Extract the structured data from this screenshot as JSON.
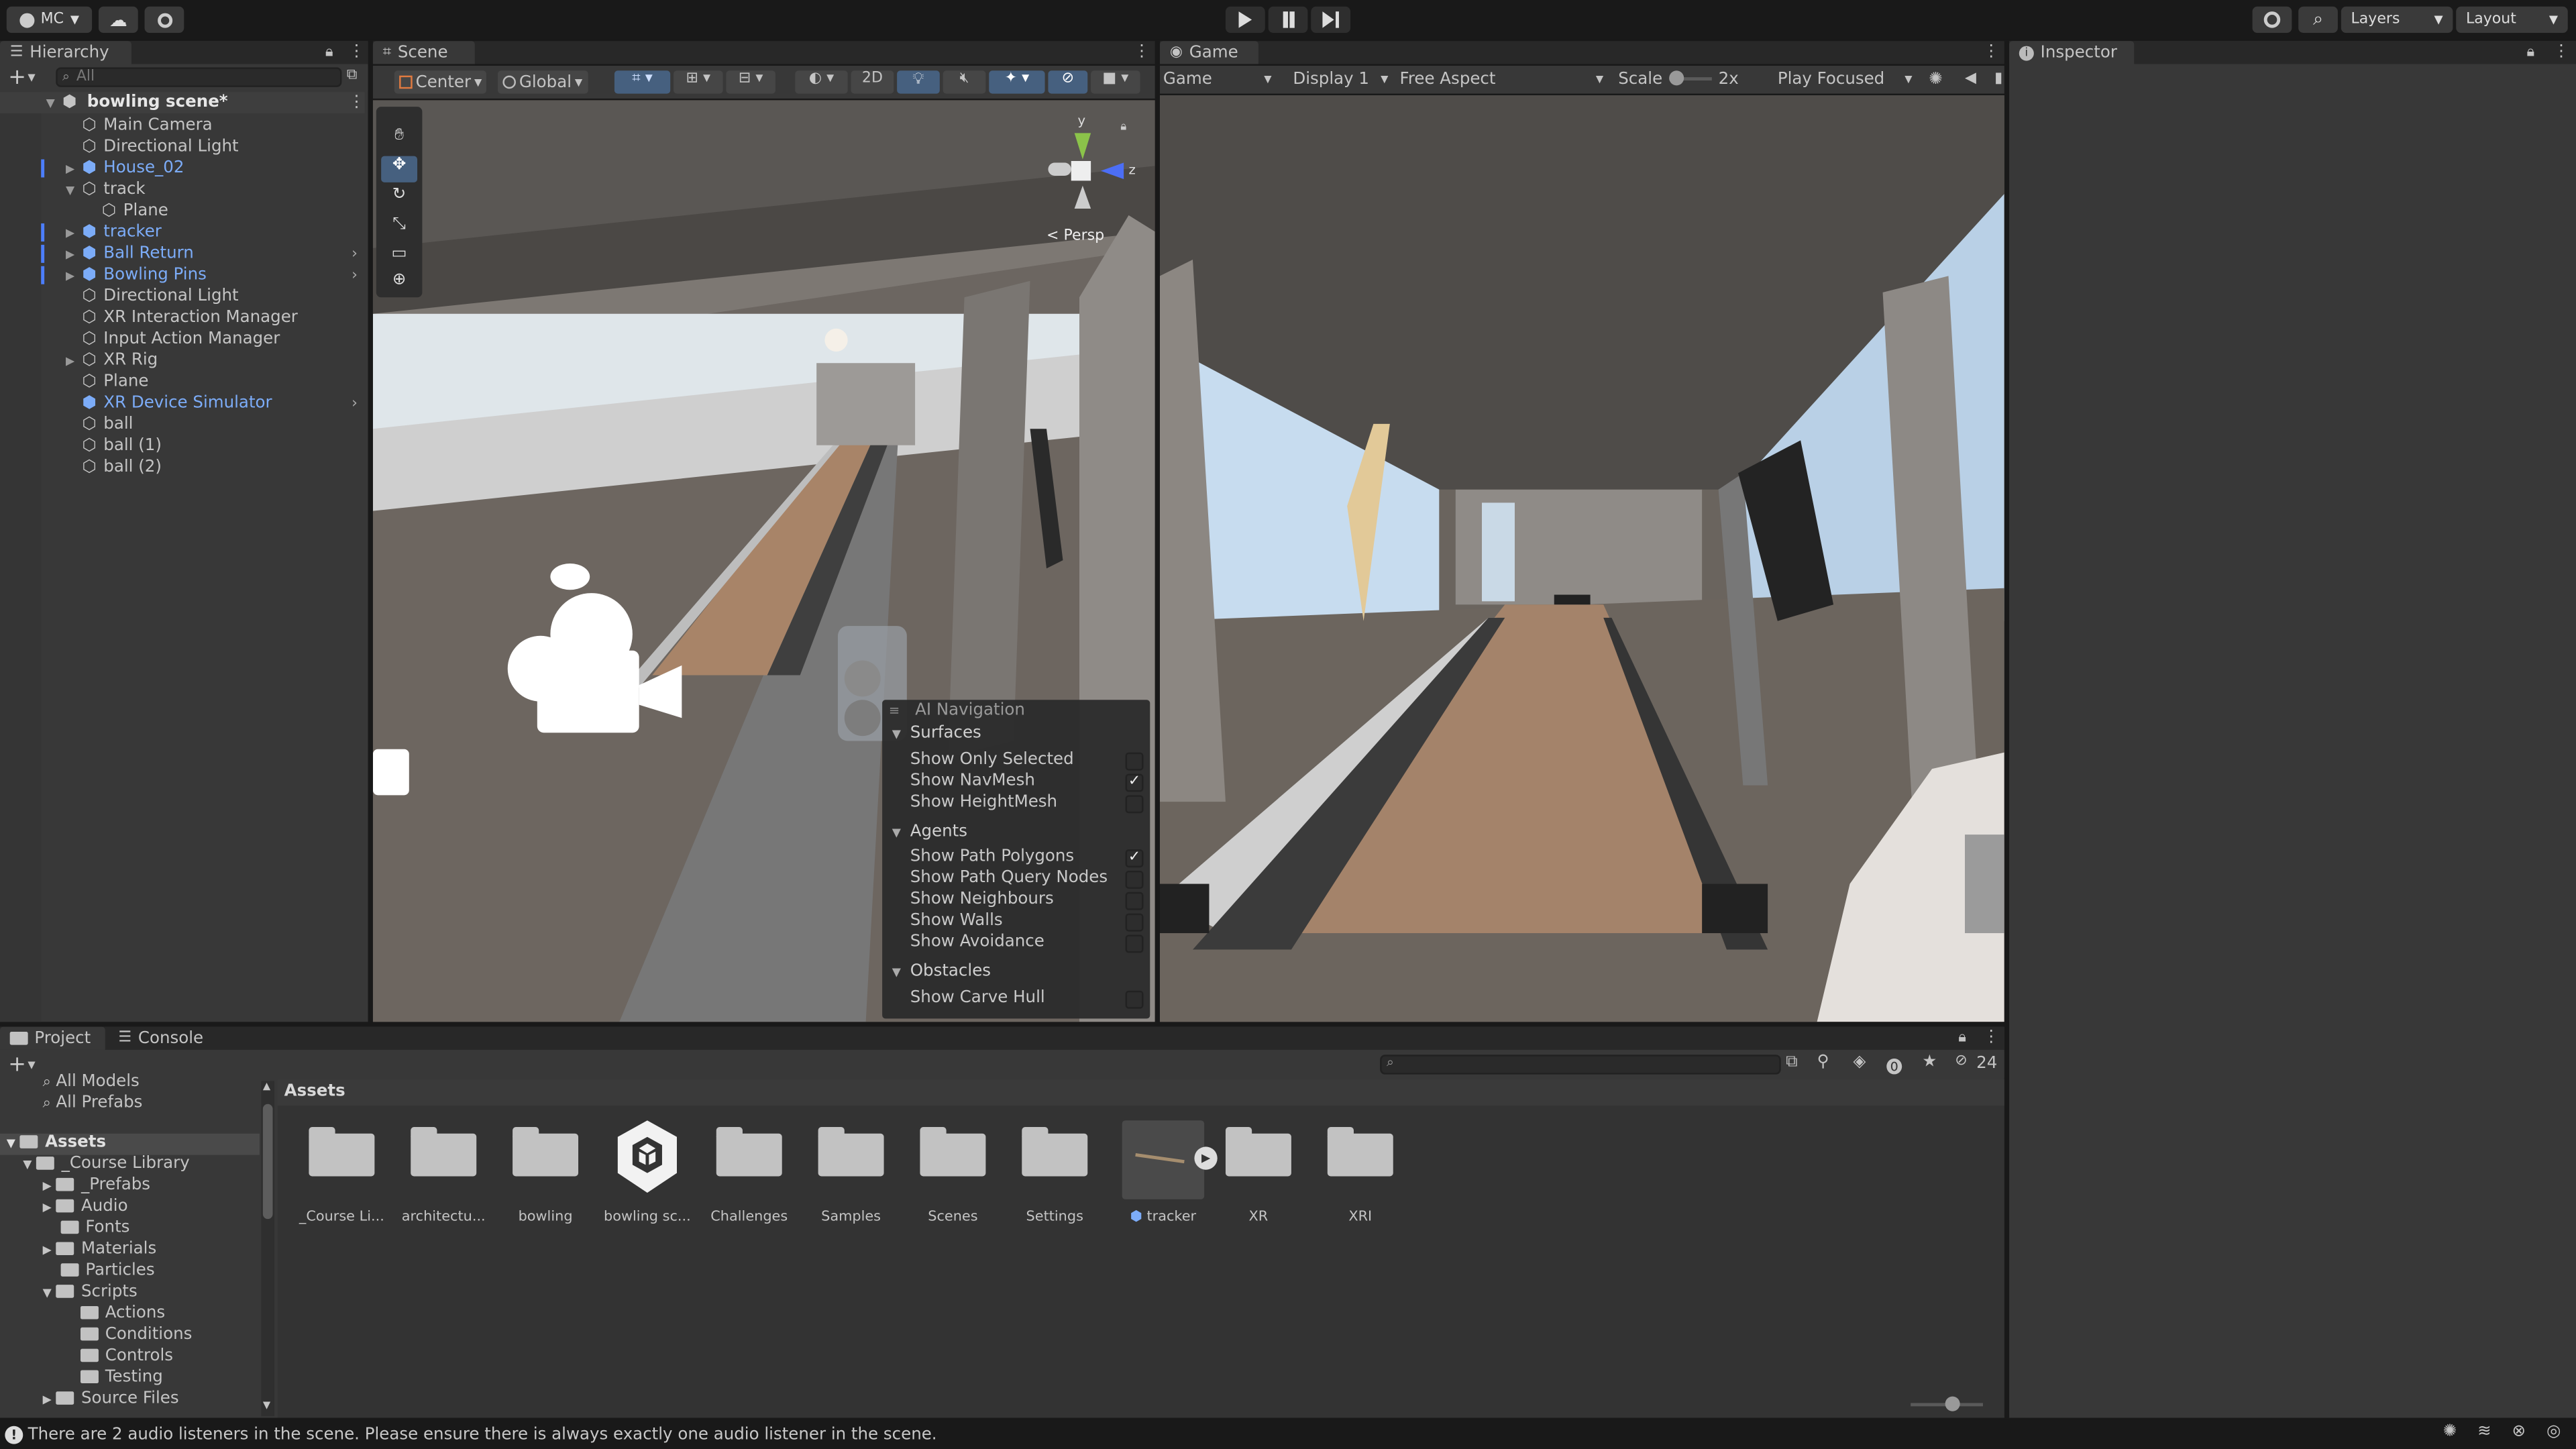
{
  "toolbar": {
    "account_label": "MC",
    "layers_label": "Layers",
    "layout_label": "Layout"
  },
  "hierarchy": {
    "tab_label": "Hierarchy",
    "search_placeholder": "All",
    "scene_name": "bowling scene*",
    "items": [
      {
        "label": "Main Camera"
      },
      {
        "label": "Directional Light"
      },
      {
        "label": "House_02"
      },
      {
        "label": "track"
      },
      {
        "label": "Plane"
      },
      {
        "label": "tracker"
      },
      {
        "label": "Ball Return"
      },
      {
        "label": "Bowling Pins"
      },
      {
        "label": "Directional Light"
      },
      {
        "label": "XR Interaction Manager"
      },
      {
        "label": "Input Action Manager"
      },
      {
        "label": "XR Rig"
      },
      {
        "label": "Plane"
      },
      {
        "label": "XR Device Simulator"
      },
      {
        "label": "ball"
      },
      {
        "label": "ball (1)"
      },
      {
        "label": "ball (2)"
      }
    ]
  },
  "scene": {
    "tab_label": "Scene",
    "pivot_label": "Center",
    "space_label": "Global",
    "mode_2d_label": "2D",
    "persp_label": "Persp",
    "gizmo_y": "y",
    "gizmo_z": "z"
  },
  "ai_navigation": {
    "title": "AI Navigation",
    "surfaces_label": "Surfaces",
    "show_only_selected": "Show Only Selected",
    "show_navmesh": "Show NavMesh",
    "show_heightmesh": "Show HeightMesh",
    "agents_label": "Agents",
    "show_path_polygons": "Show Path Polygons",
    "show_path_query_nodes": "Show Path Query Nodes",
    "show_neighbours": "Show Neighbours",
    "show_walls": "Show Walls",
    "show_avoidance": "Show Avoidance",
    "obstacles_label": "Obstacles",
    "show_carve_hull": "Show Carve Hull"
  },
  "game": {
    "tab_label": "Game",
    "view_dropdown": "Game",
    "display_dropdown": "Display 1",
    "aspect_dropdown": "Free Aspect",
    "scale_label": "Scale",
    "scale_value": "2x",
    "play_mode_dropdown": "Play Focused"
  },
  "inspector": {
    "tab_label": "Inspector"
  },
  "project": {
    "tab_label": "Project",
    "console_tab_label": "Console",
    "hidden_count": "24",
    "breadcrumb": "Assets",
    "tree": [
      {
        "label": "All Models"
      },
      {
        "label": "All Prefabs"
      },
      {
        "label": "Assets"
      },
      {
        "label": "_Course Library"
      },
      {
        "label": "_Prefabs"
      },
      {
        "label": "Audio"
      },
      {
        "label": "Fonts"
      },
      {
        "label": "Materials"
      },
      {
        "label": "Particles"
      },
      {
        "label": "Scripts"
      },
      {
        "label": "Actions"
      },
      {
        "label": "Conditions"
      },
      {
        "label": "Controls"
      },
      {
        "label": "Testing"
      },
      {
        "label": "Source Files"
      }
    ],
    "assets": [
      {
        "label": "_Course Li..."
      },
      {
        "label": "architectu..."
      },
      {
        "label": "bowling"
      },
      {
        "label": "bowling sc..."
      },
      {
        "label": "Challenges"
      },
      {
        "label": "Samples"
      },
      {
        "label": "Scenes"
      },
      {
        "label": "Settings"
      },
      {
        "label": "tracker"
      },
      {
        "label": "XR"
      },
      {
        "label": "XRI"
      }
    ]
  },
  "status": {
    "message": "There are 2 audio listeners in the scene. Please ensure there is always exactly one audio listener in the scene."
  }
}
